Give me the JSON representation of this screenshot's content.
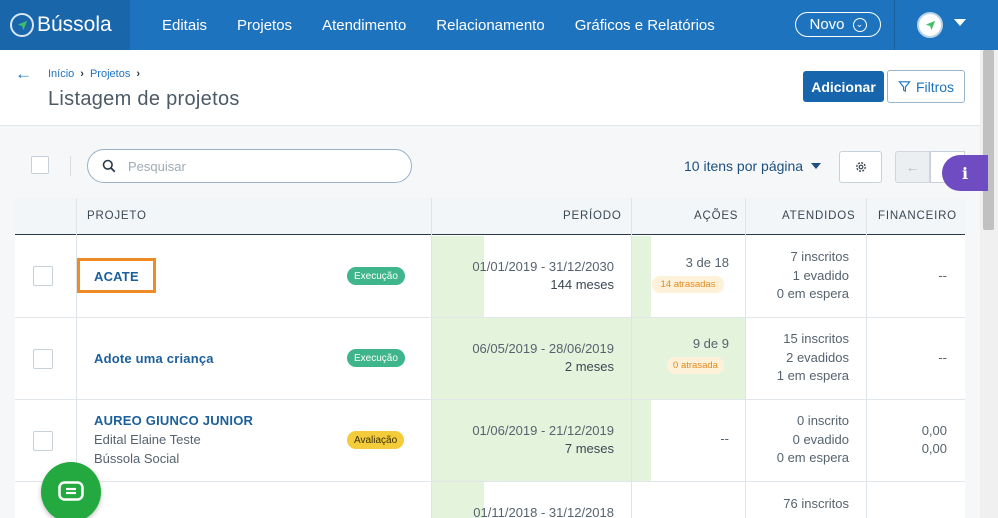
{
  "brand": {
    "name": "Bússola"
  },
  "nav": {
    "items": [
      "Editais",
      "Projetos",
      "Atendimento",
      "Relacionamento",
      "Gráficos e Relatórios"
    ],
    "novo_label": "Novo"
  },
  "breadcrumb": {
    "items": [
      "Início",
      "Projetos"
    ]
  },
  "page": {
    "title": "Listagem de projetos",
    "add_label": "Adicionar",
    "filter_label": "Filtros"
  },
  "toolbar": {
    "search_placeholder": "Pesquisar",
    "per_page_label": "10 itens por página",
    "info_label": "i"
  },
  "table": {
    "headers": {
      "projeto": "PROJETO",
      "periodo": "PERÍODO",
      "acoes": "AÇÕES",
      "atendidos": "ATENDIDOS",
      "financeiro": "FINANCEIRO"
    },
    "rows": [
      {
        "name": "ACATE",
        "sub1": "",
        "sub2": "",
        "status": "Execução",
        "period": "01/01/2019 - 31/12/2030",
        "months": "144 meses",
        "acoes": "3 de 18",
        "late": "14 atrasadas",
        "inscritos": "7 inscritos",
        "evadidos": "1 evadido",
        "espera": "0 em espera",
        "fin1": "--",
        "fin2": ""
      },
      {
        "name": "Adote uma criança",
        "sub1": "",
        "sub2": "",
        "status": "Execução",
        "period": "06/05/2019 - 28/06/2019",
        "months": "2 meses",
        "acoes": "9 de 9",
        "late": "0 atrasada",
        "inscritos": "15 inscritos",
        "evadidos": "2 evadidos",
        "espera": "1 em espera",
        "fin1": "--",
        "fin2": ""
      },
      {
        "name": "AUREO GIUNCO JUNIOR",
        "sub1": "Edital Elaine Teste",
        "sub2": "Bússola Social",
        "status": "Avaliação",
        "period": "01/06/2019 - 21/12/2019",
        "months": "7 meses",
        "acoes": "--",
        "late": "",
        "inscritos": "0 inscrito",
        "evadidos": "0 evadido",
        "espera": "0 em espera",
        "fin1": "0,00",
        "fin2": "0,00"
      },
      {
        "name": "",
        "sub1": "",
        "sub2": "",
        "status": "",
        "period": "01/11/2018 - 31/12/2018",
        "months": "",
        "acoes": "",
        "late": "",
        "inscritos": "76 inscritos",
        "evadidos": "",
        "espera": "",
        "fin1": "",
        "fin2": ""
      }
    ]
  },
  "colors": {
    "primary": "#1e73be",
    "brand_dark": "#1a66ab",
    "execucao": "#3fb58b",
    "avaliacao": "#f4cc3b",
    "highlight": "#f08a24",
    "chat": "#23a93f",
    "info": "#6f4cc2"
  }
}
